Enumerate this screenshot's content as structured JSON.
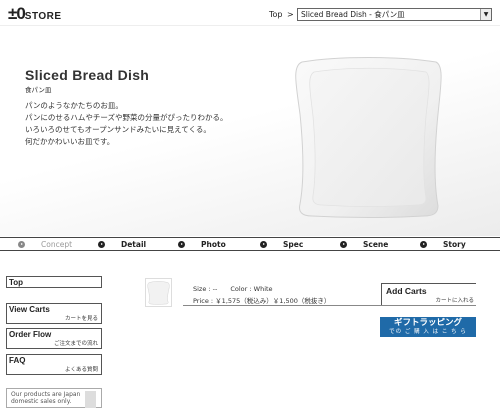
{
  "header": {
    "logo_big": "±0",
    "logo_small": "STORE",
    "top_link": "Top",
    "top_arrow": ">",
    "product_select": "Sliced Bread Dish - 食パン皿"
  },
  "hero": {
    "title": "Sliced Bread Dish",
    "subtitle": "食パン皿",
    "description": [
      "パンのようなかたちのお皿。",
      "パンにのせるハムやチーズや野菜の分量がぴったりわかる。",
      "いろいろのせてもオープンサンドみたいに見えてくる。",
      "何だかかわいいお皿です。"
    ]
  },
  "nav": {
    "items": [
      {
        "label": "Concept"
      },
      {
        "label": "Detail"
      },
      {
        "label": "Photo"
      },
      {
        "label": "Spec"
      },
      {
        "label": "Scene"
      },
      {
        "label": "Story"
      }
    ]
  },
  "sidebar": {
    "top": "Top",
    "view_carts": {
      "label": "View Carts",
      "sub": "カートを見る"
    },
    "order_flow": {
      "label": "Order Flow",
      "sub": "ご注文までの流れ"
    },
    "faq": {
      "label": "FAQ",
      "sub": "よくある質問"
    },
    "note": "Our products are Japan domestic sales only."
  },
  "product": {
    "size_color": "Size : --　　Color : White",
    "price": "Price : ￥1,575（税込み）￥1,500（税抜き）",
    "add_carts_label": "Add Carts",
    "add_carts_sub": "カートに入れる",
    "gift_main": "ギフトラッピング",
    "gift_sub": "での ご 購 入 は こ ち ら"
  },
  "colors": {
    "gift_blue": "#1f6aa8",
    "nav_border": "#444444"
  }
}
